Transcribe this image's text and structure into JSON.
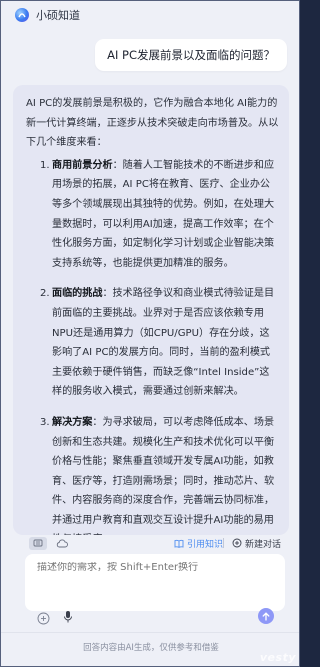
{
  "app": {
    "title": "小硕知道"
  },
  "question": "AI PC发展前景以及面临的问题？",
  "answer": {
    "intro": "AI PC的发展前景是积极的，它作为融合本地化 AI能力的新一代计算终端，正逐步从技术突破走向市场普及。从以下几个维度来看：",
    "items": [
      {
        "num": "1.",
        "heading": "商用前景分析",
        "text": "：随着人工智能技术的不断进步和应用场景的拓展，AI PC将在教育、医疗、企业办公等多个领域展现出其独特的优势。例如，在处理大量数据时，可以利用AI加速，提高工作效率；在个性化服务方面，如定制化学习计划或企业智能决策支持系统等，也能提供更加精准的服务。"
      },
      {
        "num": "2.",
        "heading": "面临的挑战",
        "text": "：技术路径争议和商业模式待验证是目前面临的主要挑战。业界对于是否应该依赖专用NPU还是通用算力（如CPU/GPU）存在分歧，这影响了AI PC的发展方向。同时，当前的盈利模式主要依赖于硬件销售，而缺乏像“Intel Inside”这样的服务收入模式，需要通过创新来解决。"
      },
      {
        "num": "3.",
        "heading": "解决方案",
        "text": "：为寻求破局，可以考虑降低成本、场景创新和生态共建。规模化生产和技术优化可以平衡价格与性能；聚焦垂直领域开发专属AI功能，如教育、医疗等，打造刚需场景；同时，推动芯片、软件、内容服务商的深度合作，完善端云协同标准，并通过用户教育和直观交互设计提升AI功能的易用性与接受度。"
      }
    ]
  },
  "actions": {
    "cite_label": "引用知识",
    "new_chat_label": "新建对话"
  },
  "input": {
    "placeholder": "描述你的需求，按 Shift+Enter换行"
  },
  "footer": "回答内容由AI生成，仅供参考和借鉴",
  "watermark": "vesty",
  "colors": {
    "accent": "#4e8df0",
    "send_button": "#8e98f7",
    "answer_bg": "#e4e6f3"
  }
}
